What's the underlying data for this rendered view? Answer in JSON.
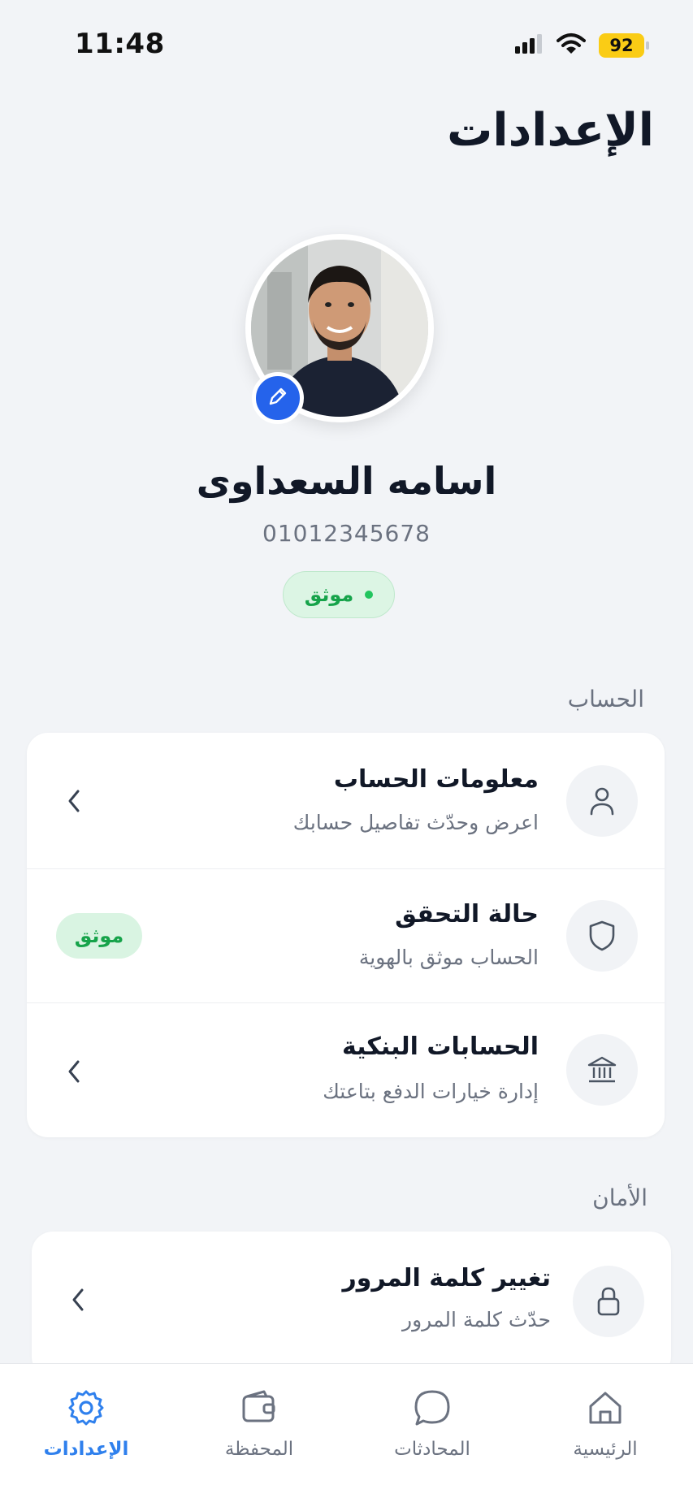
{
  "status_bar": {
    "time": "11:48",
    "battery": "92"
  },
  "header": {
    "title": "الإعدادات"
  },
  "profile": {
    "name": "اسامه السعداوى",
    "phone": "01012345678",
    "verified_label": "موثق"
  },
  "sections": {
    "account": {
      "label": "الحساب",
      "items": [
        {
          "title": "معلومات الحساب",
          "subtitle": "اعرض وحدّث تفاصيل حسابك",
          "icon": "user-icon"
        },
        {
          "title": "حالة التحقق",
          "subtitle": "الحساب موثق بالهوية",
          "icon": "shield-icon",
          "badge": "موثق"
        },
        {
          "title": "الحسابات البنكية",
          "subtitle": "إدارة خيارات الدفع بتاعتك",
          "icon": "bank-icon"
        }
      ]
    },
    "security": {
      "label": "الأمان",
      "items": [
        {
          "title": "تغيير كلمة المرور",
          "subtitle": "حدّث كلمة المرور",
          "icon": "lock-icon"
        }
      ]
    }
  },
  "bottom_nav": {
    "items": [
      {
        "label": "الإعدادات",
        "icon": "gear-icon",
        "active": true
      },
      {
        "label": "المحفظة",
        "icon": "wallet-icon",
        "active": false
      },
      {
        "label": "المحادثات",
        "icon": "chat-icon",
        "active": false
      },
      {
        "label": "الرئيسية",
        "icon": "home-icon",
        "active": false
      }
    ]
  },
  "colors": {
    "accent": "#2f80ed",
    "verified": "#16a34a",
    "battery": "#facc15"
  }
}
